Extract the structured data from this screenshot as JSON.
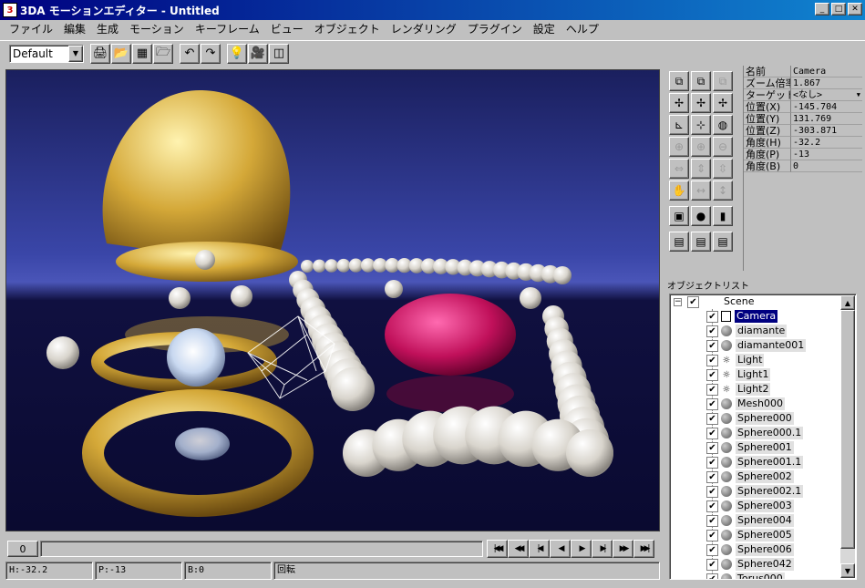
{
  "window": {
    "title": "3DA モーションエディター - Untitled",
    "icon_glyph": "3",
    "minimize_glyph": "_",
    "maximize_glyph": "□",
    "close_glyph": "✕"
  },
  "menu": [
    "ファイル",
    "編集",
    "生成",
    "モーション",
    "キーフレーム",
    "ビュー",
    "オブジェクト",
    "レンダリング",
    "プラグイン",
    "設定",
    "ヘルプ"
  ],
  "toolbar": {
    "preset_value": "Default",
    "buttons": [
      {
        "name": "print-icon",
        "glyph": "🖨"
      },
      {
        "name": "open-folder-icon",
        "glyph": "📂"
      },
      {
        "name": "grid-save-icon",
        "glyph": "▦"
      },
      {
        "name": "new-folder-icon",
        "glyph": "🗁"
      },
      {
        "name": "undo-icon",
        "glyph": "↶"
      },
      {
        "name": "redo-icon",
        "glyph": "↷"
      },
      {
        "name": "light-bulb-icon",
        "glyph": "💡"
      },
      {
        "name": "camera-icon",
        "glyph": "🎥"
      },
      {
        "name": "cube-icon",
        "glyph": "◫"
      }
    ]
  },
  "properties": [
    {
      "key": "名前",
      "value": "Camera",
      "dropdown": false
    },
    {
      "key": "ズーム倍率",
      "value": "1.867",
      "dropdown": false
    },
    {
      "key": "ターゲット",
      "value": "<なし>",
      "dropdown": true
    },
    {
      "key": "位置(X)",
      "value": "-145.704",
      "dropdown": false
    },
    {
      "key": "位置(Y)",
      "value": "131.769",
      "dropdown": false
    },
    {
      "key": "位置(Z)",
      "value": "-303.871",
      "dropdown": false
    },
    {
      "key": "角度(H)",
      "value": "-32.2",
      "dropdown": false
    },
    {
      "key": "角度(P)",
      "value": "-13",
      "dropdown": false
    },
    {
      "key": "角度(B)",
      "value": "0",
      "dropdown": false
    }
  ],
  "object_list": {
    "title": "オブジェクトリスト",
    "root": {
      "label": "Scene",
      "expander": "−"
    },
    "items": [
      {
        "label": "Camera",
        "icon": "camera",
        "selected": true
      },
      {
        "label": "diamante",
        "icon": "sphere"
      },
      {
        "label": "diamante001",
        "icon": "sphere"
      },
      {
        "label": "Light",
        "icon": "light"
      },
      {
        "label": "Light1",
        "icon": "light"
      },
      {
        "label": "Light2",
        "icon": "light"
      },
      {
        "label": "Mesh000",
        "icon": "sphere"
      },
      {
        "label": "Sphere000",
        "icon": "sphere"
      },
      {
        "label": "Sphere000.1",
        "icon": "sphere"
      },
      {
        "label": "Sphere001",
        "icon": "sphere"
      },
      {
        "label": "Sphere001.1",
        "icon": "sphere"
      },
      {
        "label": "Sphere002",
        "icon": "sphere"
      },
      {
        "label": "Sphere002.1",
        "icon": "sphere"
      },
      {
        "label": "Sphere003",
        "icon": "sphere"
      },
      {
        "label": "Sphere004",
        "icon": "sphere"
      },
      {
        "label": "Sphere005",
        "icon": "sphere"
      },
      {
        "label": "Sphere006",
        "icon": "sphere"
      },
      {
        "label": "Sphere042",
        "icon": "sphere"
      },
      {
        "label": "Torus000",
        "icon": "sphere"
      }
    ],
    "check_glyph": "✔",
    "light_glyph": "☼",
    "scroll_up": "▲",
    "scroll_down": "▼"
  },
  "timeline": {
    "frame": "0",
    "transport": [
      {
        "name": "go-start-button",
        "glyph": "|◀◀"
      },
      {
        "name": "rewind-button",
        "glyph": "◀◀"
      },
      {
        "name": "prev-key-button",
        "glyph": "|◀"
      },
      {
        "name": "step-back-button",
        "glyph": "◀"
      },
      {
        "name": "play-button",
        "glyph": "▶"
      },
      {
        "name": "next-key-button",
        "glyph": "▶|"
      },
      {
        "name": "fast-forward-button",
        "glyph": "▶▶"
      },
      {
        "name": "go-end-button",
        "glyph": "▶▶|"
      }
    ]
  },
  "status": {
    "h": "H:-32.2",
    "p": "P:-13",
    "b": "B:0",
    "mode": "回転"
  },
  "palette": [
    {
      "name": "view-front-icon",
      "glyph": "⧉",
      "dim": false
    },
    {
      "name": "view-side-icon",
      "glyph": "⧉",
      "dim": false
    },
    {
      "name": "view-top-icon",
      "glyph": "⧉",
      "dim": true
    },
    {
      "name": "move-icon",
      "glyph": "✢",
      "dim": false
    },
    {
      "name": "move-y-icon",
      "glyph": "✢",
      "dim": false
    },
    {
      "name": "move-z-icon",
      "glyph": "✢",
      "dim": false
    },
    {
      "name": "axis-icon",
      "glyph": "⊾",
      "dim": false
    },
    {
      "name": "rotate-icon",
      "glyph": "⊹",
      "dim": false
    },
    {
      "name": "globe-icon",
      "glyph": "◍",
      "dim": false
    },
    {
      "name": "zoom-in-icon",
      "glyph": "⊕",
      "dim": true
    },
    {
      "name": "zoom-icon",
      "glyph": "⊕",
      "dim": true
    },
    {
      "name": "zoom-out-icon",
      "glyph": "⊖",
      "dim": true
    },
    {
      "name": "scale-x-icon",
      "glyph": "⇔",
      "dim": true
    },
    {
      "name": "scale-y-icon",
      "glyph": "⇕",
      "dim": true
    },
    {
      "name": "scale-z-icon",
      "glyph": "⇳",
      "dim": true
    },
    {
      "name": "pan-icon",
      "glyph": "✋",
      "dim": true
    },
    {
      "name": "pan-h-icon",
      "glyph": "↔",
      "dim": true
    },
    {
      "name": "pan-v-icon",
      "glyph": "↕",
      "dim": true
    },
    {
      "name": "frame-icon",
      "glyph": "▣",
      "dim": false
    },
    {
      "name": "render-ball-icon",
      "glyph": "●",
      "dim": false
    },
    {
      "name": "camera-light-icon",
      "glyph": "▮",
      "dim": false
    },
    {
      "name": "film-icon",
      "glyph": "▤",
      "dim": false
    },
    {
      "name": "film-play-icon",
      "glyph": "▤",
      "dim": false
    },
    {
      "name": "film-stop-icon",
      "glyph": "▤",
      "dim": false
    }
  ]
}
